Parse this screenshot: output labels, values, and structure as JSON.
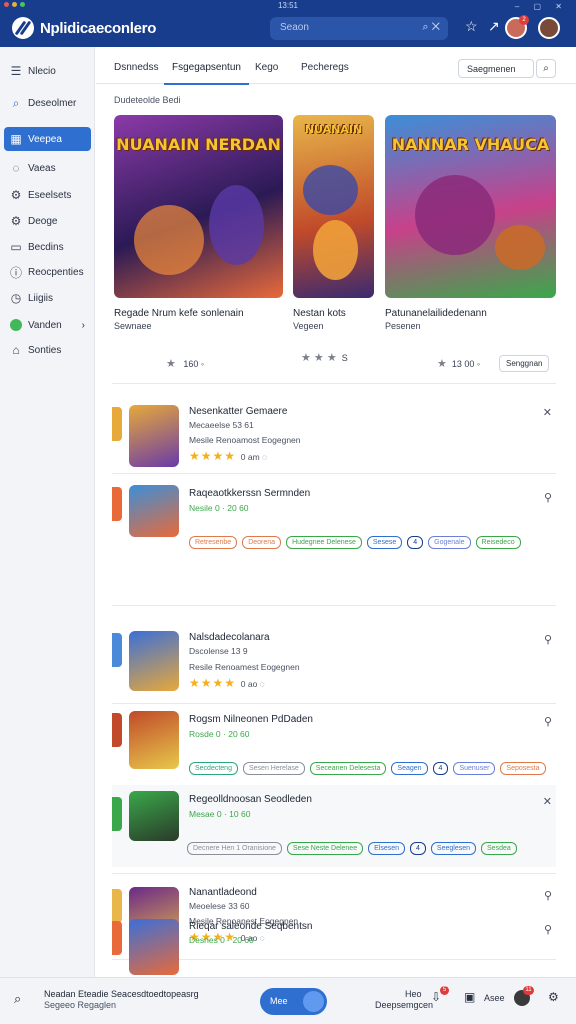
{
  "titlebar": {
    "clock": "13:51"
  },
  "header": {
    "app_title": "Nplidicaeconlero",
    "search_placeholder": "Seaon",
    "notif_count": "2"
  },
  "sidebar": {
    "items": [
      {
        "label": "Nlecio",
        "icon": "menu-icon"
      },
      {
        "label": "Deseolmer",
        "icon": "search-icon"
      },
      {
        "label": "Veepea",
        "icon": "grid-icon"
      },
      {
        "label": "Vaeas",
        "icon": "chat-icon"
      },
      {
        "label": "Eseelsets",
        "icon": "gear-icon"
      },
      {
        "label": "Deoge",
        "icon": "gear-icon"
      },
      {
        "label": "Becdins",
        "icon": "box-icon"
      },
      {
        "label": "Reocpenties",
        "icon": "info-icon"
      },
      {
        "label": "Liigiis",
        "icon": "clock-icon"
      },
      {
        "label": "Vanden",
        "icon": "status-dot-icon"
      },
      {
        "label": "Sonties",
        "icon": "home-icon"
      }
    ]
  },
  "tabs": [
    {
      "label": "Dsnnedss"
    },
    {
      "label": "Fsgegapsentun"
    },
    {
      "label": "Kego"
    },
    {
      "label": "Pecheregs"
    }
  ],
  "tab_search_label": "Saegmenen",
  "section_label": "Dudeteolde Bedi",
  "featured": [
    {
      "art_title": "NUANAIN NERDAN",
      "title": "Regade Nrum kefe sonlenain",
      "sub": "Sewnaee",
      "rating": "160",
      "colors": [
        "#8b3aa8",
        "#2a1a55",
        "#e86a3a"
      ]
    },
    {
      "art_title": "NUANAIN",
      "title": "Nestan kots",
      "sub": "Vegeen",
      "rating": "S",
      "colors": [
        "#e8b64a",
        "#c04a2a",
        "#3a2a70"
      ]
    },
    {
      "art_title": "NANNAR VHAUCA",
      "title": "Patunanelailidedenann",
      "sub": "Pesenen",
      "rating": "13 00",
      "button": "Senggnan",
      "colors": [
        "#3b8fd8",
        "#c7418a",
        "#3aa84a"
      ]
    }
  ],
  "list": [
    {
      "title": "Nesenkatter Gemaere",
      "sub1": "Mecaeelse 53 61",
      "sub2": "Mesile Renoamost Eogegnen",
      "rating": "0 am",
      "kind": "rated",
      "colors": [
        "#e6a93a",
        "#6a3aa8"
      ]
    },
    {
      "title": "Raqeaotkkerssn Sermnden",
      "sub1": "Nesile 0 · 20 60",
      "kind": "chips",
      "chips": [
        {
          "t": "Retresenbe",
          "c": "#e07a4a"
        },
        {
          "t": "Deorena",
          "c": "#e07a4a"
        },
        {
          "t": "Hudegnee Delenese",
          "c": "#3aa84a"
        },
        {
          "t": "Sesese",
          "c": "#2f6fd0"
        },
        {
          "t": "4",
          "c": "#173d8c"
        },
        {
          "t": "Gogenale",
          "c": "#6a7fd8"
        },
        {
          "t": "Reisedeco",
          "c": "#3aa84a"
        }
      ],
      "colors": [
        "#3b8fd8",
        "#e86a3a"
      ]
    },
    {
      "title": "Nalsdadecolanara",
      "sub1": "Dscolense 13 9",
      "sub2": "Resile Renoamest Eogegnen",
      "rating": "0 ao",
      "kind": "rated",
      "colors": [
        "#3b6fd8",
        "#e8a83a"
      ]
    },
    {
      "title": "Rogsm Nilneonen PdDaden",
      "sub1": "Rosde 0 · 20 60",
      "kind": "chips",
      "chips": [
        {
          "t": "Secdecteng",
          "c": "#2aa87a"
        },
        {
          "t": "Sesen Herelase",
          "c": "#8a8f9a"
        },
        {
          "t": "Seceanen Delesesta",
          "c": "#3aa84a"
        },
        {
          "t": "Seagen",
          "c": "#2f6fd0"
        },
        {
          "t": "4",
          "c": "#173d8c"
        },
        {
          "t": "Suenuser",
          "c": "#6a7fd8"
        },
        {
          "t": "Seposesta",
          "c": "#e07a4a"
        }
      ],
      "colors": [
        "#c04a2a",
        "#e8c84a"
      ]
    },
    {
      "title": "Regeolldnoosan Seodleden",
      "sub1": "Mesae 0 · 10 60",
      "kind": "chips",
      "chips": [
        {
          "t": "Decnere Hen 1 Oranisione",
          "c": "#8a8f9a"
        },
        {
          "t": "Sese Neste Delenee",
          "c": "#3aa84a"
        },
        {
          "t": "Elsesen",
          "c": "#2f6fd0"
        },
        {
          "t": "4",
          "c": "#173d8c"
        },
        {
          "t": "Seeglesen",
          "c": "#2f6fd0"
        },
        {
          "t": "Sesdea",
          "c": "#3aa84a"
        }
      ],
      "colors": [
        "#3aa84a",
        "#2a3a2a"
      ]
    },
    {
      "title": "Nanantladeond",
      "sub1": "Meoelese 33 60",
      "sub2": "Mesile Renoanest Eogegnen",
      "rating": "0 ao",
      "kind": "rated",
      "colors": [
        "#6a2a88",
        "#e8b64a"
      ]
    },
    {
      "title": "Rieqar saleonde Seqbentsn",
      "sub1": "Desnes 0 · 20 60",
      "kind": "chips",
      "chips": [],
      "colors": [
        "#3b6fd8",
        "#e86a3a"
      ]
    }
  ],
  "bottombar": {
    "line1": "Neadan Eteadie Seacesdtoedtopeasrg",
    "line2": "Segeeo Regaglen",
    "pill_label": "Mee",
    "item1": "Heo",
    "item2": "Deepsemgcen",
    "badge_count": "5",
    "item3": "Asee",
    "avatar_badge": "11"
  }
}
